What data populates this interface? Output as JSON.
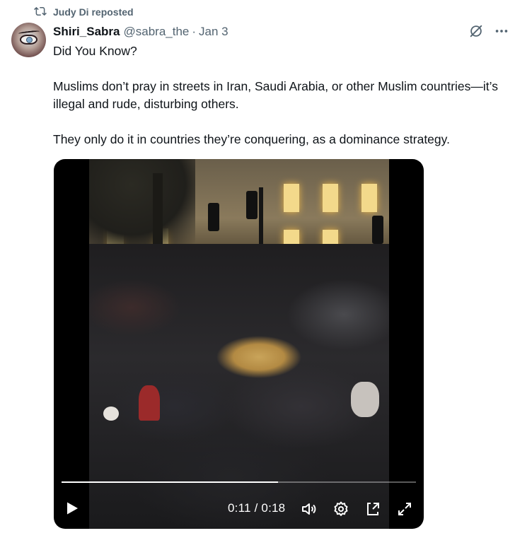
{
  "repost": {
    "label": "Judy Di reposted",
    "icon": "repost-icon"
  },
  "tweet": {
    "author_name": "Shiri_Sabra",
    "author_handle": "@sabra_the",
    "separator": "·",
    "date": "Jan 3",
    "text_line1": "Did You Know?",
    "text_line2": "Muslims don’t pray in streets in Iran, Saudi Arabia, or other Muslim countries—it’s illegal and rude, disturbing others.",
    "text_line3": "They only do it in countries they’re conquering, as a dominance strategy."
  },
  "top_actions": {
    "grok_icon": "grok-icon",
    "more_icon": "more-options-icon"
  },
  "video": {
    "current_time": "0:11",
    "separator": " / ",
    "duration": "0:18",
    "progress": 0.61,
    "icons": [
      "play-icon",
      "volume-icon",
      "settings-icon",
      "pip-icon",
      "fullscreen-icon"
    ]
  },
  "colors": {
    "text_primary": "#0f1419",
    "text_secondary": "#536471",
    "video_bg": "#000000"
  }
}
